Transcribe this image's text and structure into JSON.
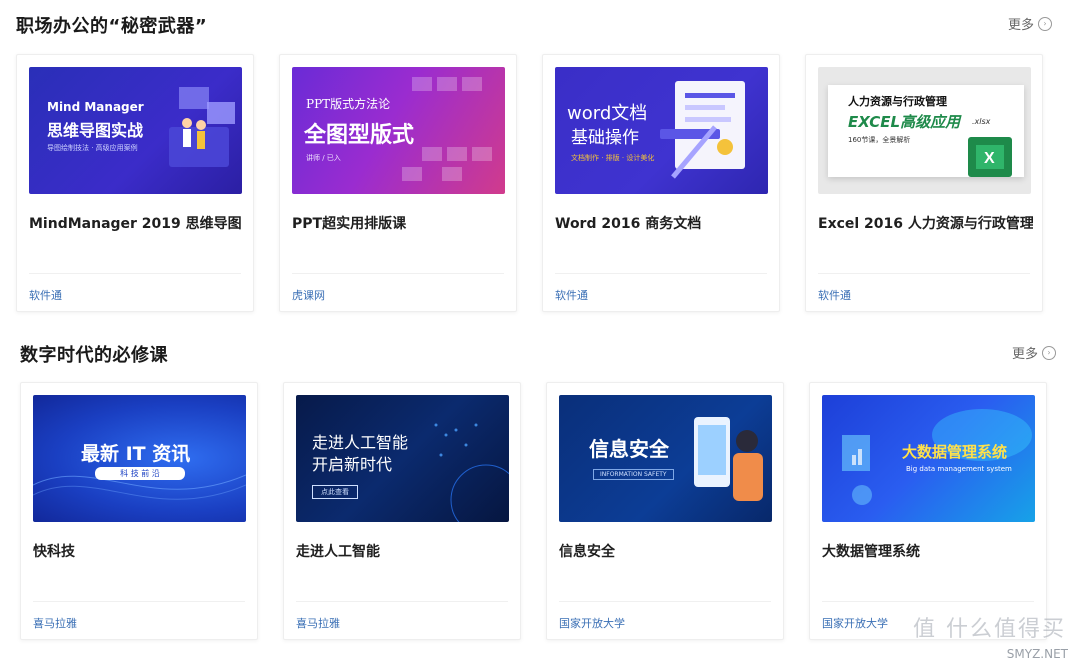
{
  "sections": [
    {
      "title": "职场办公的“秘密武器”",
      "more_label": "更多",
      "cards": [
        {
          "title": "MindManager 2019 思维导图",
          "source": "软件通",
          "thumb": {
            "line1": "Mind Manager",
            "line2": "思维导图实战",
            "line3": "导图绘制技法 · 高级应用案例"
          }
        },
        {
          "title": "PPT超实用排版课",
          "source": "虎课网",
          "thumb": {
            "line1": "PPT版式方法论",
            "line2": "全图型版式",
            "line3": "讲师 / 已入"
          }
        },
        {
          "title": "Word 2016 商务文档",
          "source": "软件通",
          "thumb": {
            "line1": "word文档",
            "line2": "基础操作",
            "line3": "文档制作 · 排版 · 设计美化"
          }
        },
        {
          "title": "Excel 2016 人力资源与行政管理",
          "source": "软件通",
          "thumb": {
            "line1": "人力资源与行政管理",
            "line2": "EXCEL高级应用",
            "line2b": ".xlsx",
            "line3": "160节课，全景解析"
          }
        }
      ]
    },
    {
      "title": "数字时代的必修课",
      "more_label": "更多",
      "cards": [
        {
          "title": "快科技",
          "source": "喜马拉雅",
          "thumb": {
            "line1": "最新 IT 资讯",
            "line2": "科 技 前 沿"
          }
        },
        {
          "title": "走进人工智能",
          "source": "喜马拉雅",
          "thumb": {
            "line1": "走进人工智能",
            "line2": "开启新时代",
            "line3": "点此查看"
          }
        },
        {
          "title": "信息安全",
          "source": "国家开放大学",
          "thumb": {
            "line1": "信息安全",
            "line2": "INFORMATION SAFETY"
          }
        },
        {
          "title": "大数据管理系统",
          "source": "国家开放大学",
          "thumb": {
            "line1": "大数据管理系统",
            "line2": "Big data management system"
          }
        }
      ]
    }
  ],
  "watermark": {
    "text1": "值 什么值得买",
    "text2": "SMYZ.NET"
  }
}
